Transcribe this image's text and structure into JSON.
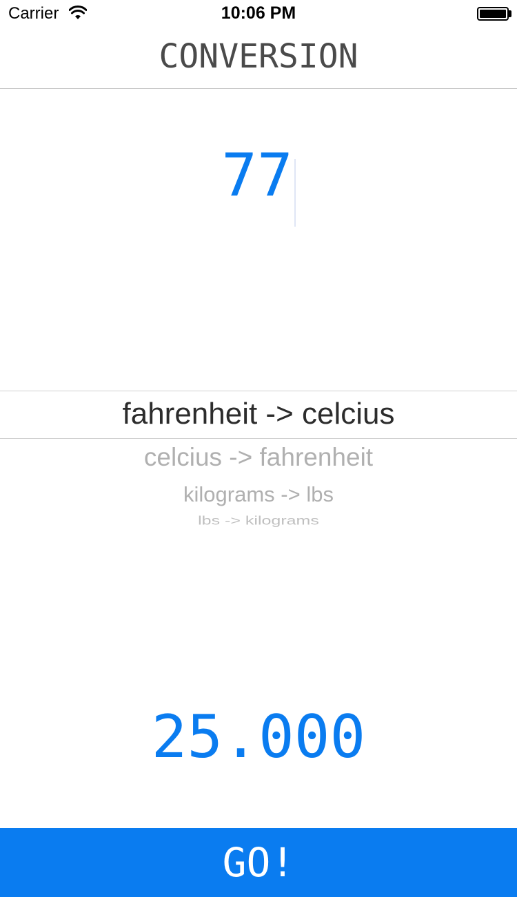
{
  "status_bar": {
    "carrier": "Carrier",
    "time": "10:06 PM"
  },
  "nav": {
    "title": "CONVERSION"
  },
  "input": {
    "value": "77"
  },
  "picker": {
    "selected": "fahrenheit -> celcius",
    "options": [
      "celcius -> fahrenheit",
      "kilograms -> lbs",
      "lbs -> kilograms"
    ]
  },
  "result": {
    "value": "25.000"
  },
  "go_button": {
    "label": "GO!"
  },
  "colors": {
    "accent": "#0a7cf0",
    "title_text": "#4a4a4a",
    "picker_inactive": "#b0b0b0"
  },
  "icons": [
    "wifi-icon",
    "battery-icon"
  ]
}
